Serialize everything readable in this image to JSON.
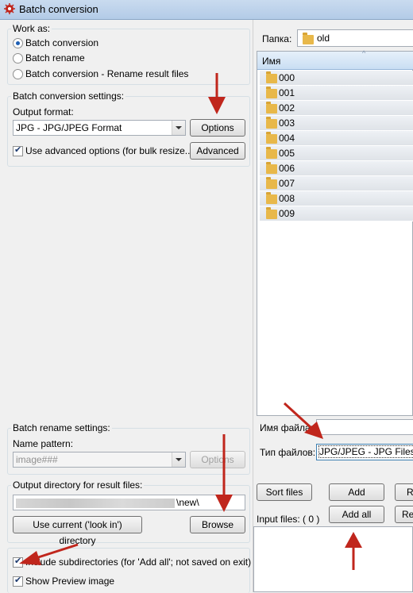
{
  "window": {
    "title": "Batch conversion"
  },
  "work_as": {
    "legend": "Work as:",
    "options": [
      "Batch conversion",
      "Batch rename",
      "Batch conversion - Rename result files"
    ]
  },
  "conversion": {
    "legend": "Batch conversion settings:",
    "output_format_label": "Output format:",
    "format_value": "JPG - JPG/JPEG Format",
    "options_button": "Options",
    "advanced_checkbox": "Use advanced options (for bulk resize...)",
    "advanced_button": "Advanced"
  },
  "rename": {
    "legend": "Batch rename settings:",
    "pattern_label": "Name pattern:",
    "pattern_value": "image###",
    "options_button": "Options"
  },
  "output": {
    "legend": "Output directory for result files:",
    "path_suffix": "\\new\\",
    "use_current_button": "Use current ('look in') directory",
    "browse_button": "Browse"
  },
  "checks": {
    "include_subdirs": "Include subdirectories (for 'Add all'; not saved on exit)",
    "show_preview": "Show Preview image"
  },
  "browser": {
    "folder_label": "Папка:",
    "folder_value": "old",
    "column_name": "Имя",
    "items": [
      "000",
      "001",
      "002",
      "003",
      "004",
      "005",
      "006",
      "007",
      "008",
      "009"
    ],
    "filename_label": "Имя файла:",
    "filetype_label": "Тип файлов:",
    "filetype_value": "JPG/JPEG - JPG Files"
  },
  "actions": {
    "sort_files": "Sort files",
    "add": "Add",
    "add_all": "Add all",
    "input_files_label": "Input files: ( 0 )",
    "cut_r1": "R",
    "cut_r2": "Rei"
  },
  "colors": {
    "arrow": "#c0261c",
    "accent": "#1e5fb4"
  }
}
